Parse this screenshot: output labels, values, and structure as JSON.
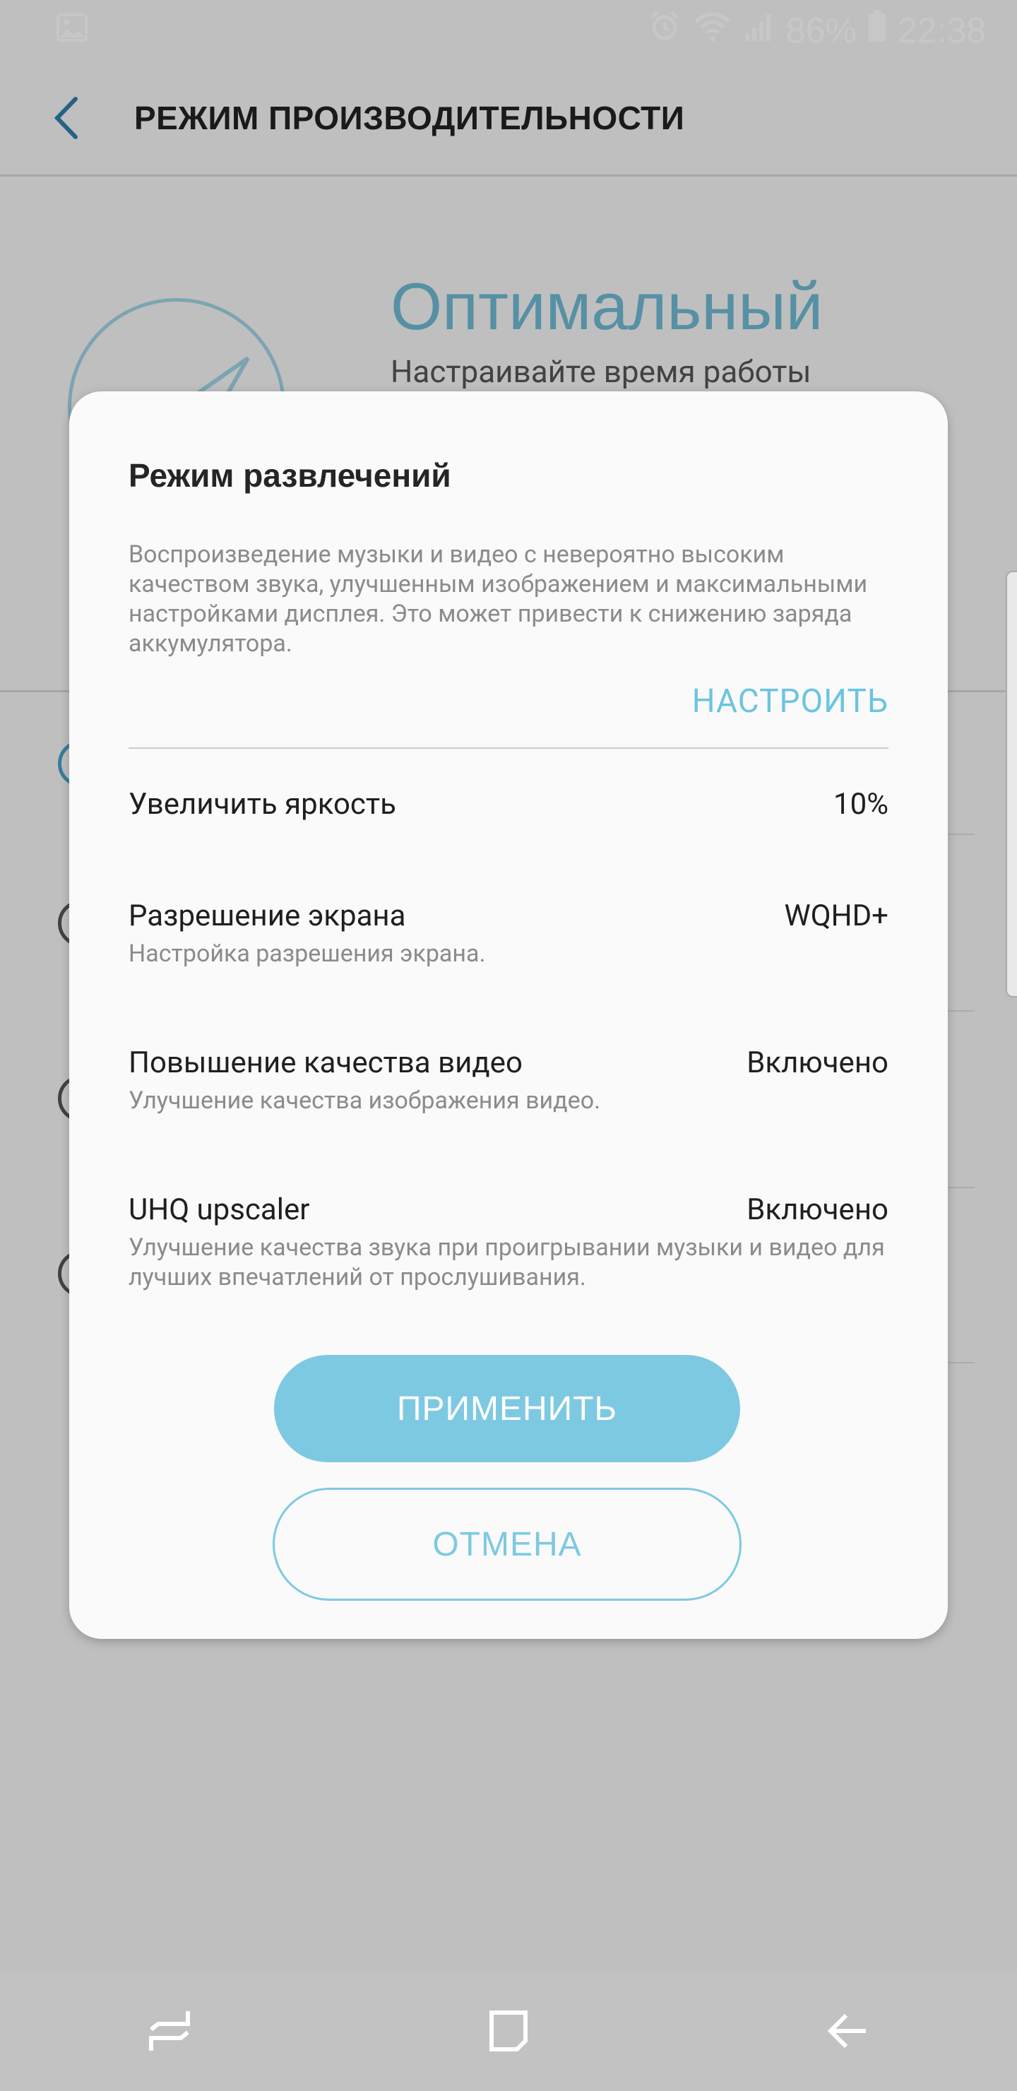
{
  "status_bar": {
    "battery": "86%",
    "time": "22:38",
    "icons": [
      "image-icon",
      "alarm-icon",
      "wifi-icon",
      "signal-icon",
      "battery-icon"
    ]
  },
  "header": {
    "title": "РЕЖИМ ПРОИЗВОДИТЕЛЬНОСТИ",
    "back_icon": "chevron-left-icon"
  },
  "background": {
    "mode_title": "Оптимальный",
    "mode_subtitle": "Настраивайте время работы"
  },
  "dialog": {
    "title": "Режим развлечений",
    "description": "Воспроизведение музыки и видео с невероятно высоким качеством звука, улучшенным изображением и максимальными настройками дисплея. Это может привести к снижению заряда аккумулятора.",
    "customize_label": "НАСТРОИТЬ",
    "settings": [
      {
        "label": "Увеличить яркость",
        "value": "10%",
        "sub": ""
      },
      {
        "label": "Разрешение экрана",
        "value": "WQHD+",
        "sub": "Настройка разрешения экрана."
      },
      {
        "label": "Повышение качества видео",
        "value": "Включено",
        "sub": "Улучшение качества изображения видео."
      },
      {
        "label": "UHQ upscaler",
        "value": "Включено",
        "sub": "Улучшение качества звука при проигрывании музыки и видео для лучших впечатлений от прослушивания."
      }
    ],
    "apply_label": "ПРИМЕНИТЬ",
    "cancel_label": "ОТМЕНА"
  },
  "nav_bar": {
    "icons": [
      "recent-apps-icon",
      "home-icon",
      "back-icon"
    ]
  },
  "colors": {
    "accent": "#7ec9e2",
    "accent_text": "#6cc4e0"
  }
}
